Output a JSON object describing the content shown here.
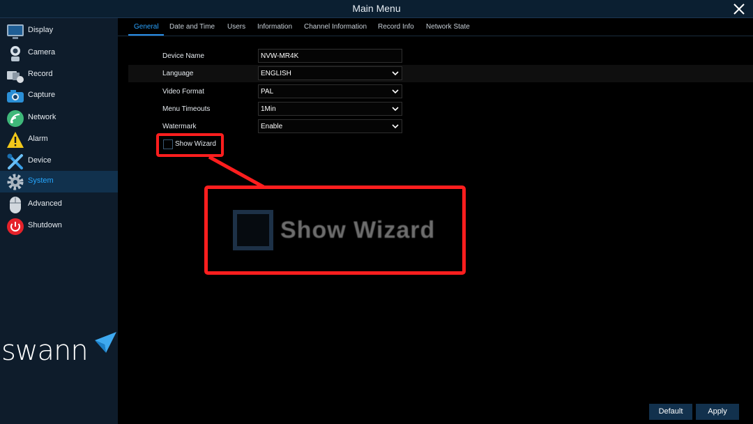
{
  "window": {
    "title": "Main Menu"
  },
  "sidebar": {
    "items": [
      {
        "label": "Display",
        "icon": "display-icon"
      },
      {
        "label": "Camera",
        "icon": "camera-icon"
      },
      {
        "label": "Record",
        "icon": "record-icon"
      },
      {
        "label": "Capture",
        "icon": "capture-icon"
      },
      {
        "label": "Network",
        "icon": "network-icon"
      },
      {
        "label": "Alarm",
        "icon": "alarm-icon"
      },
      {
        "label": "Device",
        "icon": "device-icon"
      },
      {
        "label": "System",
        "icon": "system-icon",
        "active": true
      },
      {
        "label": "Advanced",
        "icon": "advanced-icon"
      },
      {
        "label": "Shutdown",
        "icon": "shutdown-icon"
      }
    ],
    "brand": "swann"
  },
  "tabs": [
    {
      "label": "General",
      "active": true
    },
    {
      "label": "Date and Time"
    },
    {
      "label": "Users"
    },
    {
      "label": "Information"
    },
    {
      "label": "Channel Information"
    },
    {
      "label": "Record Info"
    },
    {
      "label": "Network State"
    }
  ],
  "form": {
    "device_name": {
      "label": "Device Name",
      "value": "NVW-MR4K"
    },
    "language": {
      "label": "Language",
      "value": "ENGLISH"
    },
    "video_format": {
      "label": "Video Format",
      "value": "PAL"
    },
    "menu_timeouts": {
      "label": "Menu Timeouts",
      "value": "1Min"
    },
    "watermark": {
      "label": "Watermark",
      "value": "Enable"
    },
    "show_wizard": {
      "label": "Show Wizard",
      "checked": false
    }
  },
  "callout": {
    "label": "Show Wizard"
  },
  "buttons": {
    "default": "Default",
    "apply": "Apply"
  },
  "colors": {
    "accent": "#2aa3ff",
    "highlight": "#ff1e1e",
    "active_nav": "#11314d",
    "button": "#12314d"
  }
}
